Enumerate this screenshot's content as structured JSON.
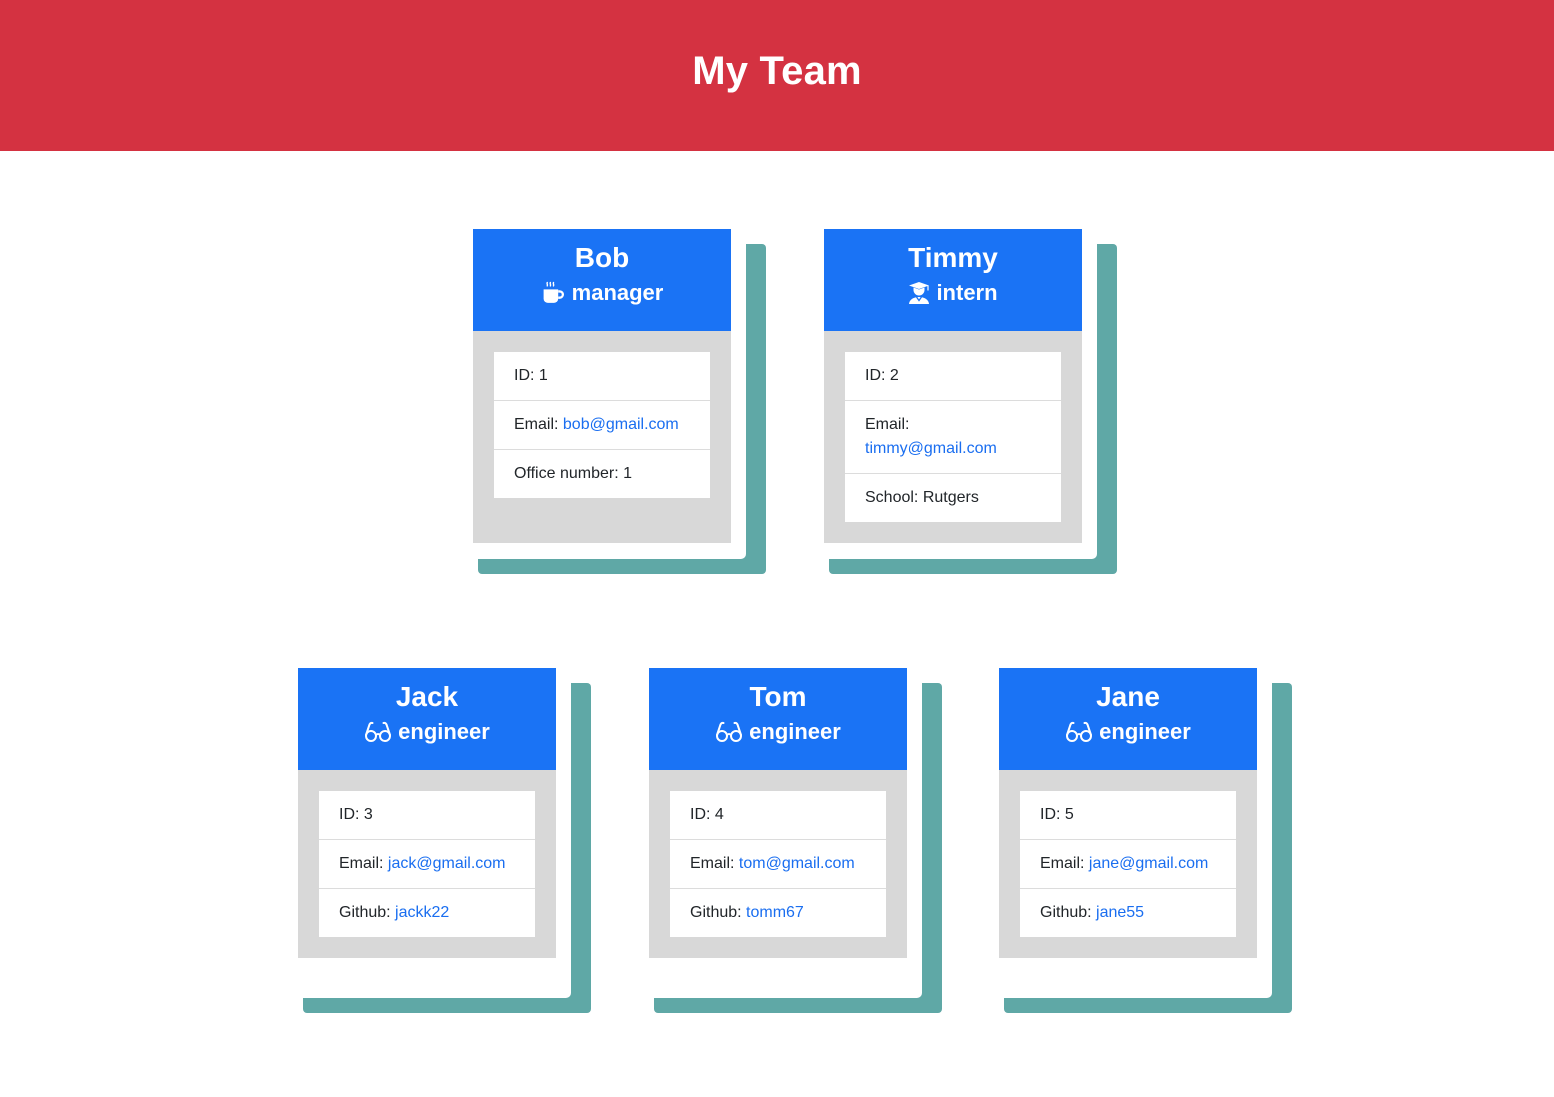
{
  "header": {
    "title": "My Team"
  },
  "colors": {
    "header_bg": "#d43241",
    "card_header_bg": "#1a73f5",
    "card_body_bg": "#d8d8d8",
    "card_shadow": "#5fa8a6",
    "link": "#1a6ef0"
  },
  "team": [
    {
      "name": "Bob",
      "role": "manager",
      "icon": "mug-hot-icon",
      "id_label": "ID: 1",
      "email_prefix": "Email: ",
      "email": "bob@gmail.com",
      "extra_label": "Office number: 1",
      "extra_link": ""
    },
    {
      "name": "Timmy",
      "role": "intern",
      "icon": "user-graduate-icon",
      "id_label": "ID: 2",
      "email_prefix": "Email: ",
      "email": "timmy@gmail.com",
      "extra_label": "School: Rutgers",
      "extra_link": ""
    },
    {
      "name": "Jack",
      "role": "engineer",
      "icon": "glasses-icon",
      "id_label": "ID: 3",
      "email_prefix": "Email: ",
      "email": "jack@gmail.com",
      "extra_label": "Github: ",
      "extra_link": "jackk22"
    },
    {
      "name": "Tom",
      "role": "engineer",
      "icon": "glasses-icon",
      "id_label": "ID: 4",
      "email_prefix": "Email: ",
      "email": "tom@gmail.com",
      "extra_label": "Github: ",
      "extra_link": "tomm67"
    },
    {
      "name": "Jane",
      "role": "engineer",
      "icon": "glasses-icon",
      "id_label": "ID: 5",
      "email_prefix": "Email: ",
      "email": "jane@gmail.com",
      "extra_label": "Github: ",
      "extra_link": "jane55"
    }
  ]
}
